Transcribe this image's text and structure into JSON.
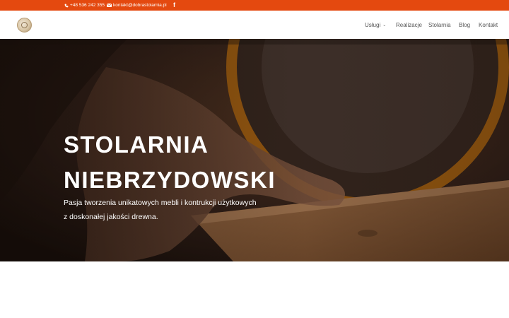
{
  "topbar": {
    "phone_icon": "phone-icon",
    "phone": "+48 536 242 355",
    "email_icon": "envelope-icon",
    "email": "kontakt@dobrastolarnia.pl",
    "facebook_icon": "f"
  },
  "nav": {
    "items": [
      {
        "label": "Usługi",
        "has_dropdown": true
      },
      {
        "label": "Realizacje"
      },
      {
        "label": "Stolarnia"
      },
      {
        "label": "Blog"
      },
      {
        "label": "Kontakt"
      }
    ]
  },
  "hero": {
    "title_line1": "STOLARNIA",
    "title_line2": "NIEBRZYDOWSKI",
    "subtitle_line1": "Pasja tworzenia unikatowych mebli i kontrukcji użytkowych",
    "subtitle_line2": "z doskonałej jakości drewna."
  },
  "colors": {
    "topbar": "#e4490f",
    "hero_dark": "#2a1a12",
    "saw_orange": "#c9760f"
  }
}
